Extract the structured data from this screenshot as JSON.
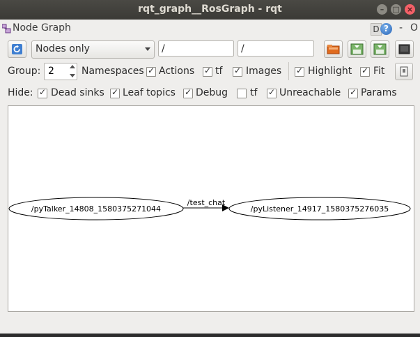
{
  "window": {
    "title": "rqt_graph__RosGraph - rqt"
  },
  "plugin": {
    "label": "Node Graph",
    "d_label": "D",
    "help": "?",
    "dash": "-",
    "close": "O"
  },
  "toolbar": {
    "mode": "Nodes only",
    "node_filter": "/",
    "topic_filter": "/"
  },
  "group": {
    "label": "Group:",
    "value": "2"
  },
  "options": {
    "namespaces": "Namespaces",
    "actions": "Actions",
    "tf": "tf",
    "images": "Images",
    "highlight": "Highlight",
    "fit": "Fit"
  },
  "hide": {
    "label": "Hide:",
    "dead_sinks": "Dead sinks",
    "leaf_topics": "Leaf topics",
    "debug": "Debug",
    "tf": "tf",
    "unreachable": "Unreachable",
    "params": "Params"
  },
  "checks": {
    "namespaces": true,
    "actions": true,
    "images": true,
    "highlight": true,
    "fit": true,
    "dead_sinks": true,
    "leaf_topics": true,
    "debug": true,
    "hide_tf": false,
    "unreachable": true,
    "params": true
  },
  "graph": {
    "talker": "/pyTalker_14808_1580375271044",
    "listener": "/pyListener_14917_1580375276035",
    "topic": "/test_chat"
  },
  "colors": {
    "close_button": "#f46067",
    "titlebar": "#3b3a36"
  }
}
